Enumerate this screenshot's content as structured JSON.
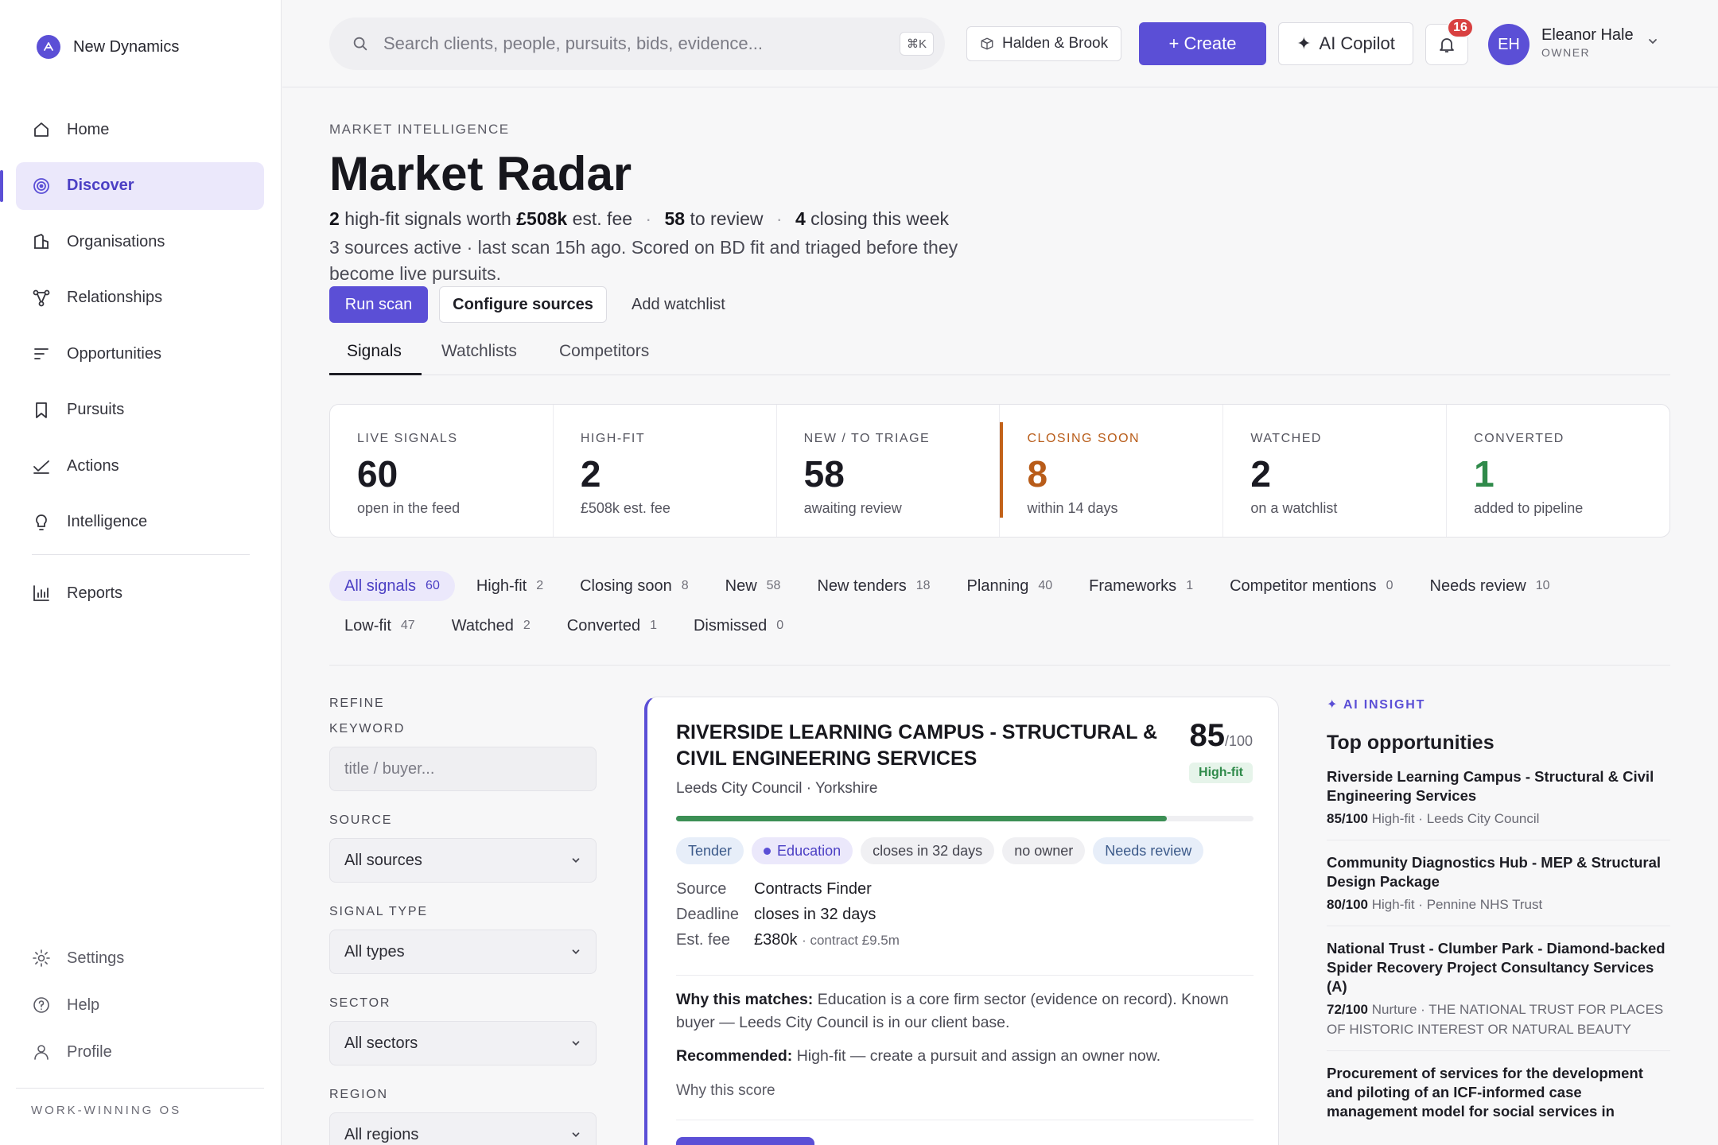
{
  "brand": {
    "name": "New Dynamics"
  },
  "sidebar": {
    "items": [
      {
        "label": "Home",
        "icon": "home-icon"
      },
      {
        "label": "Discover",
        "icon": "radar-icon",
        "active": true
      },
      {
        "label": "Organisations",
        "icon": "building-icon"
      },
      {
        "label": "Relationships",
        "icon": "network-icon"
      },
      {
        "label": "Opportunities",
        "icon": "list-icon"
      },
      {
        "label": "Pursuits",
        "icon": "bookmark-icon"
      },
      {
        "label": "Actions",
        "icon": "check-icon"
      },
      {
        "label": "Intelligence",
        "icon": "lightbulb-icon"
      },
      {
        "label": "Reports",
        "icon": "bar-chart-icon"
      }
    ],
    "bottom": [
      {
        "label": "Settings",
        "icon": "gear-icon"
      },
      {
        "label": "Help",
        "icon": "help-icon"
      },
      {
        "label": "Profile",
        "icon": "person-icon"
      }
    ],
    "footer": "WORK-WINNING OS"
  },
  "topbar": {
    "search_placeholder": "Search clients, people, pursuits, bids, evidence...",
    "search_shortcut": "⌘K",
    "workspace": "Halden & Brook",
    "create_label": "+ Create",
    "copilot_label": "AI Copilot",
    "notifications": "16",
    "user": {
      "initials": "EH",
      "name": "Eleanor Hale",
      "role": "OWNER"
    }
  },
  "header": {
    "eyebrow": "MARKET INTELLIGENCE",
    "title": "Market Radar",
    "summary": {
      "high_fit_count": "2",
      "high_fit_text": "high-fit signals worth",
      "fee": "£508k",
      "fee_text": "est. fee",
      "review_count": "58",
      "review_text": "to review",
      "closing_count": "4",
      "closing_text": "closing this week"
    },
    "subtext": "3 sources active · last scan 15h ago. Scored on BD fit and triaged before they become live pursuits.",
    "run_scan": "Run scan",
    "configure_sources": "Configure sources",
    "add_watchlist": "Add watchlist"
  },
  "tabs": [
    {
      "label": "Signals",
      "active": true
    },
    {
      "label": "Watchlists"
    },
    {
      "label": "Competitors"
    }
  ],
  "stats": [
    {
      "label": "LIVE SIGNALS",
      "value": "60",
      "sub": "open in the feed"
    },
    {
      "label": "HIGH-FIT",
      "value": "2",
      "sub": "£508k est. fee"
    },
    {
      "label": "NEW / TO TRIAGE",
      "value": "58",
      "sub": "awaiting review"
    },
    {
      "label": "CLOSING SOON",
      "value": "8",
      "sub": "within 14 days"
    },
    {
      "label": "WATCHED",
      "value": "2",
      "sub": "on a watchlist"
    },
    {
      "label": "CONVERTED",
      "value": "1",
      "sub": "added to pipeline"
    }
  ],
  "filters": {
    "row1": [
      {
        "label": "All signals",
        "count": "60",
        "active": true
      },
      {
        "label": "High-fit",
        "count": "2"
      },
      {
        "label": "Closing soon",
        "count": "8"
      },
      {
        "label": "New",
        "count": "58"
      },
      {
        "label": "New tenders",
        "count": "18"
      },
      {
        "label": "Planning",
        "count": "40"
      },
      {
        "label": "Frameworks",
        "count": "1"
      },
      {
        "label": "Competitor mentions",
        "count": "0"
      },
      {
        "label": "Needs review",
        "count": "10"
      }
    ],
    "row2": [
      {
        "label": "Low-fit",
        "count": "47"
      },
      {
        "label": "Watched",
        "count": "2"
      },
      {
        "label": "Converted",
        "count": "1"
      },
      {
        "label": "Dismissed",
        "count": "0"
      }
    ]
  },
  "refine": {
    "heading": "REFINE",
    "keyword_label": "KEYWORD",
    "keyword_placeholder": "title / buyer...",
    "source_label": "SOURCE",
    "source_value": "All sources",
    "type_label": "SIGNAL TYPE",
    "type_value": "All types",
    "sector_label": "SECTOR",
    "sector_value": "All sectors",
    "region_label": "REGION",
    "region_value": "All regions"
  },
  "signal_card": {
    "title": "RIVERSIDE LEARNING CAMPUS - STRUCTURAL & CIVIL ENGINEERING SERVICES",
    "buyer": "Leeds City Council · Yorkshire",
    "score": "85",
    "score_max": "/100",
    "score_fraction": 0.85,
    "fit": "High-fit",
    "tags": [
      "Tender",
      "Education",
      "closes in 32 days",
      "no owner",
      "Needs review"
    ],
    "source_label": "Source",
    "source": "Contracts Finder",
    "deadline_label": "Deadline",
    "deadline": "closes in 32 days",
    "fee_label": "Est. fee",
    "fee": "£380k",
    "contract": "· contract £9.5m",
    "why_label": "Why this matches:",
    "why": "Education is a core firm sector (evidence on record). Known buyer — Leeds City Council is in our client base.",
    "rec_label": "Recommended:",
    "rec": "High-fit — create a pursuit and assign an owner now.",
    "why_score": "Why this score"
  },
  "insight": {
    "label": "AI INSIGHT",
    "title": "Top opportunities",
    "items": [
      {
        "name": "Riverside Learning Campus - Structural & Civil Engineering Services",
        "score": "85/100",
        "meta": "High-fit · Leeds City Council"
      },
      {
        "name": "Community Diagnostics Hub - MEP & Structural Design Package",
        "score": "80/100",
        "meta": "High-fit · Pennine NHS Trust"
      },
      {
        "name": "National Trust - Clumber Park - Diamond-backed Spider Recovery Project Consultancy Services (A)",
        "score": "72/100",
        "meta": "Nurture · THE NATIONAL TRUST FOR PLACES OF HISTORIC INTEREST OR NATURAL BEAUTY"
      },
      {
        "name": "Procurement of services for the development and piloting of an ICF-informed case management model for social services in",
        "score": "",
        "meta": ""
      }
    ]
  }
}
